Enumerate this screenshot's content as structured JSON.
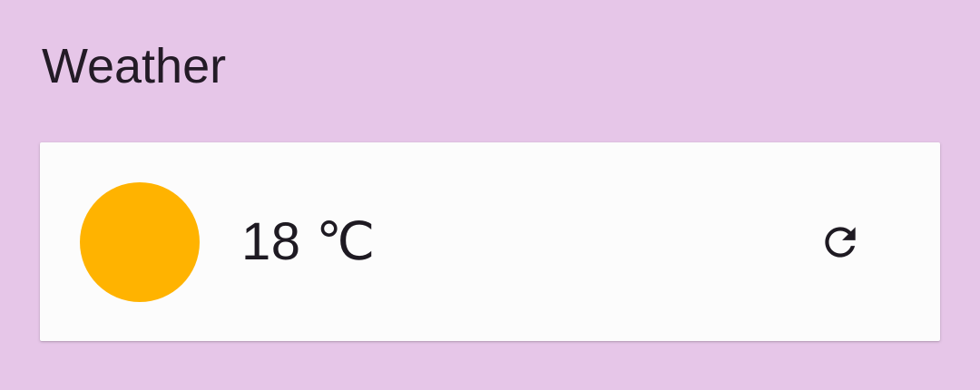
{
  "colors": {
    "background": "#E6C6E8",
    "card": "#FCFCFC",
    "sun": "#FFB300",
    "text": "#1E1A22"
  },
  "header": {
    "title": "Weather"
  },
  "weather_card": {
    "condition_icon": "sun-icon",
    "temperature": "18 ℃",
    "refresh_icon": "refresh-icon"
  }
}
